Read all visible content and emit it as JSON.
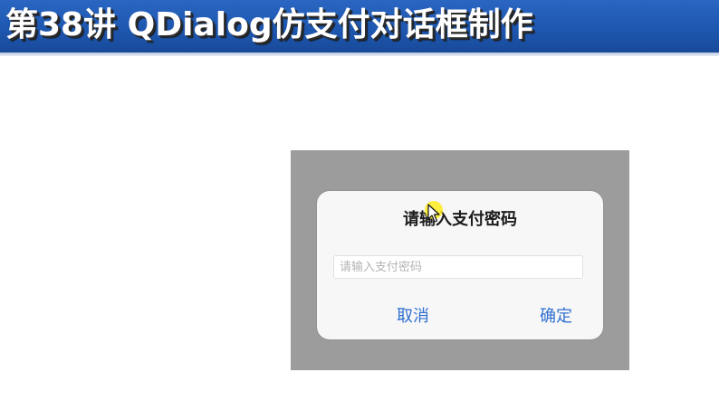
{
  "slide": {
    "title": "第38讲 QDialog仿支付对话框制作",
    "colors": {
      "title_bar": "#1e57b0",
      "title_text": "#ffffff",
      "overlay": "#9c9c9c",
      "dialog_bg": "#f7f7f7",
      "button_text": "#2f6fd1",
      "cursor_highlight": "#ffec1e"
    }
  },
  "dialog": {
    "title": "请输入支付密码",
    "input": {
      "placeholder": "请输入支付密码",
      "value": ""
    },
    "buttons": {
      "cancel": "取消",
      "confirm": "确定"
    }
  },
  "cursor": {
    "icon": "arrow-cursor-icon"
  }
}
